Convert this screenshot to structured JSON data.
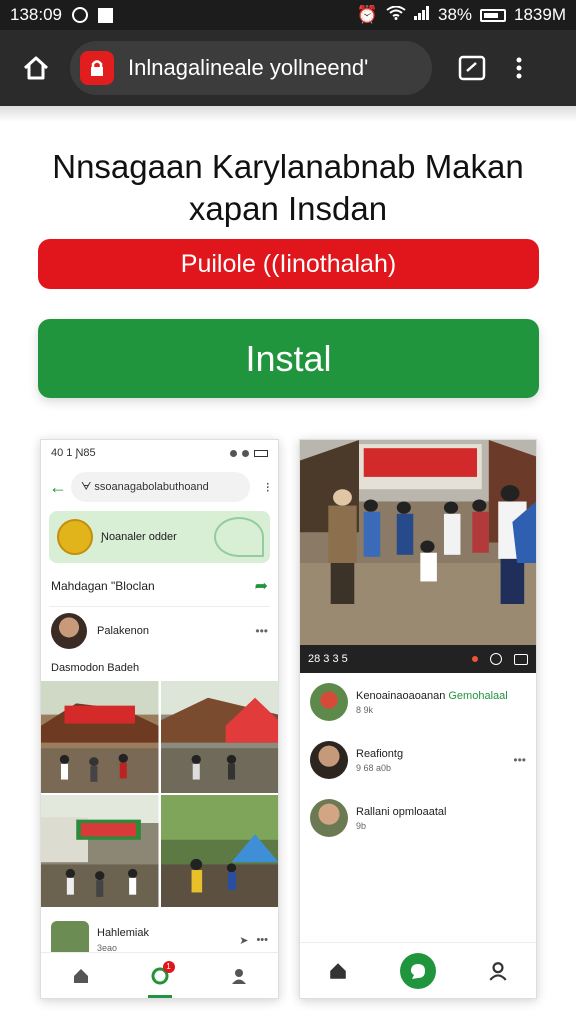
{
  "status_bar": {
    "time": "138:09",
    "right_text": "38%",
    "right_time": "1839M"
  },
  "browser": {
    "url": "Inlnagalineale yollneend'"
  },
  "headline": {
    "line1": "Nnsagaan Karylanabnab Makan",
    "line2": "xapan Insdan"
  },
  "red_button": {
    "label": "Puilole ((Iinothalah)"
  },
  "install_button": {
    "label": "Instal"
  },
  "left_phone": {
    "status_time": "40 1 Ɲ85",
    "search_text": "ᗄ ssoanagabolabuthoand",
    "banner_text": "Ɲoanaler odder",
    "section_title": "Mahdagan \"Bloclan",
    "user_name": "Palakenon",
    "caption": "Dasmodon Badeh",
    "post_title": "Hahlemiak",
    "post_meta": "3eao",
    "badge": "1"
  },
  "right_phone": {
    "video_time": "28 3 3 5",
    "items": [
      {
        "title": "Kenoainaoaoanan",
        "title_green": "Gemohalaal",
        "sub": "8 9k"
      },
      {
        "title": "Reafiontg",
        "title_green": "",
        "sub": "9 68 a0b"
      },
      {
        "title": "Rallani opmloaatal",
        "title_green": "",
        "sub": "9b"
      }
    ]
  },
  "icons": {
    "home": "home-icon",
    "lock": "lock-icon",
    "tabs": "tab-switcher-icon",
    "menu": "overflow-menu-icon",
    "back": "back-arrow-icon",
    "search": "search-icon",
    "share": "share-icon"
  },
  "colors": {
    "red": "#e0161c",
    "green": "#21953d",
    "dark": "#2b2b2b"
  }
}
